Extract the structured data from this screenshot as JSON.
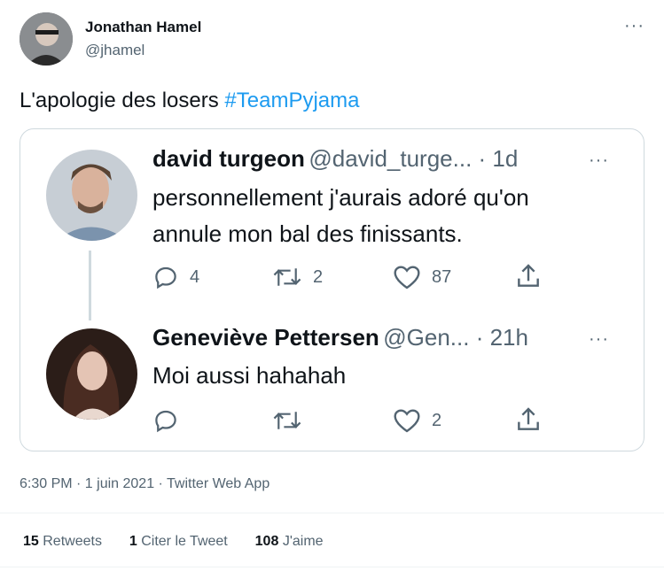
{
  "tweet": {
    "author_name": "Jonathan Hamel",
    "author_handle": "@jhamel",
    "more_label": "···",
    "text_prefix": "L'apologie des losers ",
    "hashtag": "#TeamPyjama",
    "timestamp": "6:30 PM · 1 juin 2021 · Twitter Web App",
    "stats": {
      "retweets_count": "15",
      "retweets_label": "Retweets",
      "quotes_count": "1",
      "quotes_label": "Citer le Tweet",
      "likes_count": "108",
      "likes_label": "J'aime"
    }
  },
  "quoted": [
    {
      "name": "david turgeon",
      "handle_time": "@david_turge... · 1d",
      "more_label": "···",
      "text_line1": "personnellement j'aurais adoré qu'on",
      "text_line2": "annule mon bal des finissants.",
      "replies": "4",
      "retweets": "2",
      "likes": "87"
    },
    {
      "name": "Geneviève Pettersen",
      "handle_time": "@Gen... · 21h",
      "more_label": "···",
      "text_line1": "Moi aussi hahahah",
      "replies": "",
      "retweets": "",
      "likes": "2"
    }
  ],
  "icons": {
    "reply": "reply-icon",
    "retweet": "retweet-icon",
    "like": "heart-icon",
    "share": "share-icon",
    "more": "more-icon"
  },
  "colors": {
    "accent": "#1d9bf0",
    "secondary_text": "#536471",
    "border": "#cfd9de"
  }
}
